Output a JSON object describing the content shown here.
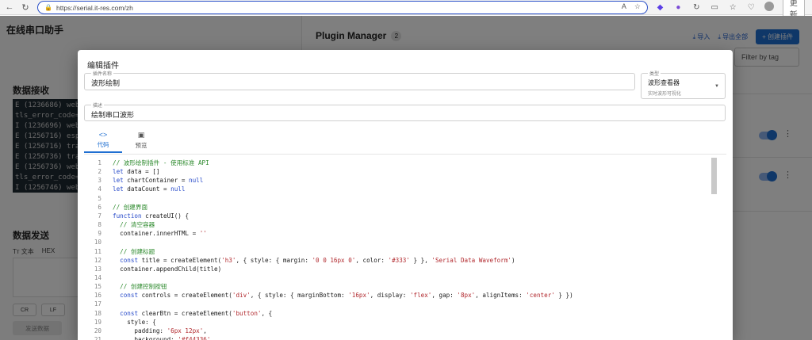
{
  "browser": {
    "url": "https://serial.it-res.com/zh",
    "update_label": "更新"
  },
  "app": {
    "title": "在线串口助手",
    "receive_title": "数据接收",
    "terminal_lines": [
      "E (1236686) web",
      "tls_error_code=",
      "I (1236696) web",
      "E (1256716) esp",
      "E (1256716) tra",
      "E (1256736) tra",
      "E (1256736) web",
      "tls_error_code=",
      "I (1256746) web"
    ],
    "send_title": "数据发送",
    "mode_text": "Tт 文本",
    "mode_hex": "HEX",
    "chip_cr": "CR",
    "chip_lf": "LF",
    "send_button": "发送数据"
  },
  "plugin_manager": {
    "title": "Plugin Manager",
    "count": "2",
    "import_label": "导入",
    "export_label": "导出全部",
    "create_label": "+ 创建插件",
    "filter_placeholder": "Filter by tag"
  },
  "modal": {
    "title": "编辑插件",
    "name_label": "插件名称",
    "name_value": "波形绘制",
    "type_label": "类型",
    "type_value": "波形查看器",
    "type_help": "实时波形可视化",
    "desc_label": "描述",
    "desc_value": "绘制串口波形",
    "tab_code": "代码",
    "tab_preview": "预览"
  },
  "code_lines": [
    {
      "n": "1",
      "parts": [
        {
          "t": "// 波形绘制插件 - 使用标准 API",
          "c": "com"
        }
      ]
    },
    {
      "n": "2",
      "parts": [
        {
          "t": "let",
          "c": "kw"
        },
        {
          "t": " data = []",
          "c": ""
        }
      ]
    },
    {
      "n": "3",
      "parts": [
        {
          "t": "let",
          "c": "kw"
        },
        {
          "t": " chartContainer = ",
          "c": ""
        },
        {
          "t": "null",
          "c": "kw"
        }
      ]
    },
    {
      "n": "4",
      "parts": [
        {
          "t": "let",
          "c": "kw"
        },
        {
          "t": " dataCount = ",
          "c": ""
        },
        {
          "t": "null",
          "c": "kw"
        }
      ]
    },
    {
      "n": "5",
      "parts": []
    },
    {
      "n": "6",
      "parts": [
        {
          "t": "// 创建界面",
          "c": "com"
        }
      ]
    },
    {
      "n": "7",
      "parts": [
        {
          "t": "function",
          "c": "kw"
        },
        {
          "t": " createUI() {",
          "c": ""
        }
      ]
    },
    {
      "n": "8",
      "parts": [
        {
          "t": "  // 清空容器",
          "c": "com"
        }
      ]
    },
    {
      "n": "9",
      "parts": [
        {
          "t": "  container.innerHTML = ",
          "c": ""
        },
        {
          "t": "''",
          "c": "str"
        }
      ]
    },
    {
      "n": "10",
      "parts": []
    },
    {
      "n": "11",
      "parts": [
        {
          "t": "  // 创建标题",
          "c": "com"
        }
      ]
    },
    {
      "n": "12",
      "parts": [
        {
          "t": "  ",
          "c": ""
        },
        {
          "t": "const",
          "c": "kw"
        },
        {
          "t": " title = createElement(",
          "c": ""
        },
        {
          "t": "'h3'",
          "c": "str"
        },
        {
          "t": ", { style: { margin: ",
          "c": ""
        },
        {
          "t": "'0 0 16px 0'",
          "c": "str"
        },
        {
          "t": ", color: ",
          "c": ""
        },
        {
          "t": "'#333'",
          "c": "str"
        },
        {
          "t": " } }, ",
          "c": ""
        },
        {
          "t": "'Serial Data Waveform'",
          "c": "str"
        },
        {
          "t": ")",
          "c": ""
        }
      ]
    },
    {
      "n": "13",
      "parts": [
        {
          "t": "  container.appendChild(title)",
          "c": ""
        }
      ]
    },
    {
      "n": "14",
      "parts": []
    },
    {
      "n": "15",
      "parts": [
        {
          "t": "  // 创建控制按钮",
          "c": "com"
        }
      ]
    },
    {
      "n": "16",
      "parts": [
        {
          "t": "  ",
          "c": ""
        },
        {
          "t": "const",
          "c": "kw"
        },
        {
          "t": " controls = createElement(",
          "c": ""
        },
        {
          "t": "'div'",
          "c": "str"
        },
        {
          "t": ", { style: { marginBottom: ",
          "c": ""
        },
        {
          "t": "'16px'",
          "c": "str"
        },
        {
          "t": ", display: ",
          "c": ""
        },
        {
          "t": "'flex'",
          "c": "str"
        },
        {
          "t": ", gap: ",
          "c": ""
        },
        {
          "t": "'8px'",
          "c": "str"
        },
        {
          "t": ", alignItems: ",
          "c": ""
        },
        {
          "t": "'center'",
          "c": "str"
        },
        {
          "t": " } })",
          "c": ""
        }
      ]
    },
    {
      "n": "17",
      "parts": []
    },
    {
      "n": "18",
      "parts": [
        {
          "t": "  ",
          "c": ""
        },
        {
          "t": "const",
          "c": "kw"
        },
        {
          "t": " clearBtn = createElement(",
          "c": ""
        },
        {
          "t": "'button'",
          "c": "str"
        },
        {
          "t": ", {",
          "c": ""
        }
      ]
    },
    {
      "n": "19",
      "parts": [
        {
          "t": "    style: {",
          "c": ""
        }
      ]
    },
    {
      "n": "20",
      "parts": [
        {
          "t": "      padding: ",
          "c": ""
        },
        {
          "t": "'6px 12px'",
          "c": "str"
        },
        {
          "t": ",",
          "c": ""
        }
      ]
    },
    {
      "n": "21",
      "parts": [
        {
          "t": "      background: ",
          "c": ""
        },
        {
          "t": "'#f44336'",
          "c": "str"
        },
        {
          "t": ",",
          "c": ""
        }
      ]
    }
  ]
}
